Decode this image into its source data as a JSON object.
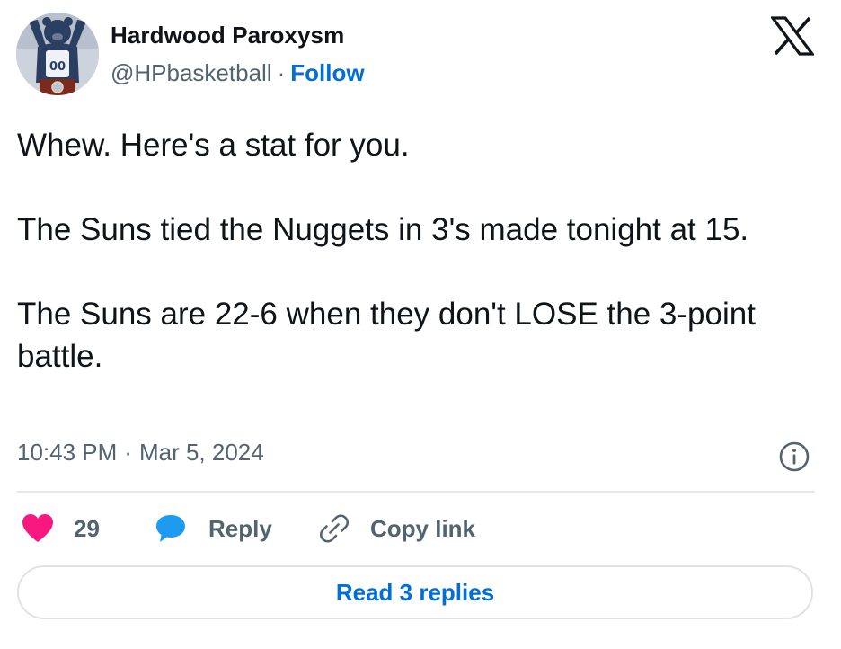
{
  "author": {
    "name": "Hardwood Paroxysm",
    "handle": "@HPbasketball",
    "separator": "·",
    "follow_label": "Follow",
    "avatar_jersey_number": "00"
  },
  "tweet": {
    "paragraphs": [
      "Whew. Here's a stat for you.",
      "The Suns tied the Nuggets in 3's made tonight at 15.",
      "The Suns are 22-6 when they don't LOSE the 3-point battle."
    ],
    "time": "10:43 PM",
    "date": "Mar 5, 2024",
    "separator": "·"
  },
  "actions": {
    "like_count": "29",
    "reply_label": "Reply",
    "copy_link_label": "Copy link",
    "read_replies_label": "Read 3 replies"
  },
  "icons": {
    "platform_logo": "x-logo-icon",
    "info": "info-icon",
    "like": "heart-icon",
    "reply": "speech-bubble-icon",
    "copy_link": "link-icon"
  },
  "colors": {
    "text": "#0f1419",
    "secondary_text": "#536471",
    "link": "#006fd6",
    "heart": "#f91880",
    "reply_bubble": "#1d9bf0",
    "divider": "#e4e8eb"
  }
}
